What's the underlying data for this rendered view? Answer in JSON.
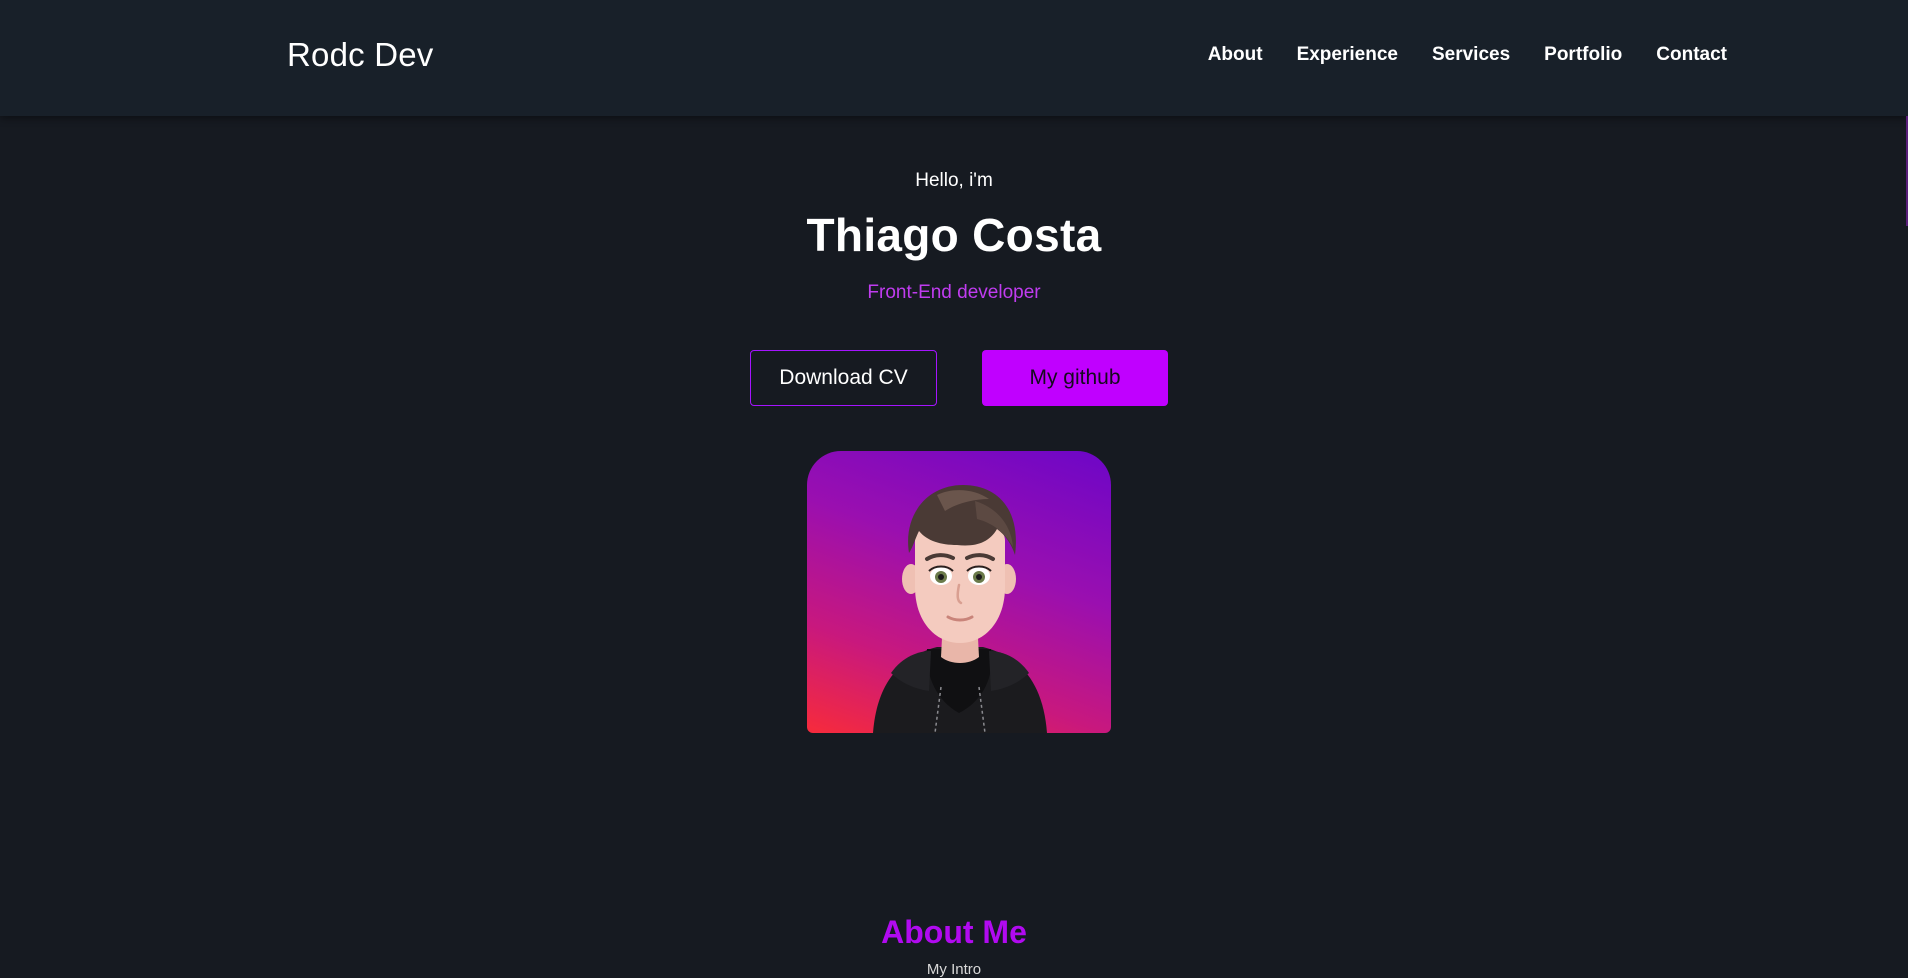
{
  "header": {
    "brand": "Rodc Dev",
    "nav": [
      "About",
      "Experience",
      "Services",
      "Portfolio",
      "Contact"
    ]
  },
  "hero": {
    "greeting": "Hello, i'm",
    "name": "Thiago Costa",
    "role": "Front-End developer",
    "download_label": "Download CV",
    "github_label": "My github"
  },
  "about": {
    "title": "About Me",
    "subtitle": "My Intro"
  },
  "colors": {
    "background": "#161a21",
    "navbar": "#182029",
    "accent": "#c000ff",
    "role_text": "#c03cf0",
    "about_title": "#b10af0"
  }
}
